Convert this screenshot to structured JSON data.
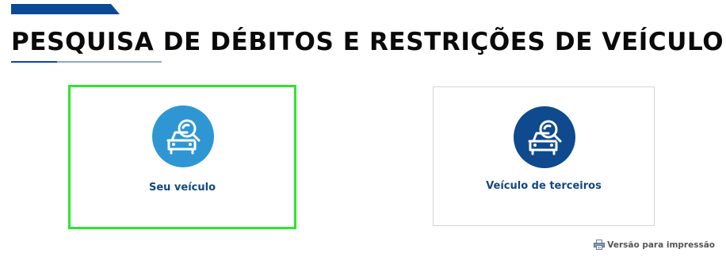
{
  "page": {
    "title": "PESQUISA DE DÉBITOS E RESTRIÇÕES DE VEÍCULO"
  },
  "options": [
    {
      "label": "Seu veículo",
      "icon": "car-search-icon",
      "icon_color": "#2e97d3",
      "selected": true
    },
    {
      "label": "Veículo de terceiros",
      "icon": "car-search-icon",
      "icon_color": "#0e4a8d",
      "selected": false
    }
  ],
  "print_link": {
    "label": "Versão para impressão",
    "icon": "printer-icon"
  },
  "colors": {
    "brand_blue": "#0b4a99",
    "selection_border": "#2ee52e",
    "label_text": "#13477f"
  }
}
